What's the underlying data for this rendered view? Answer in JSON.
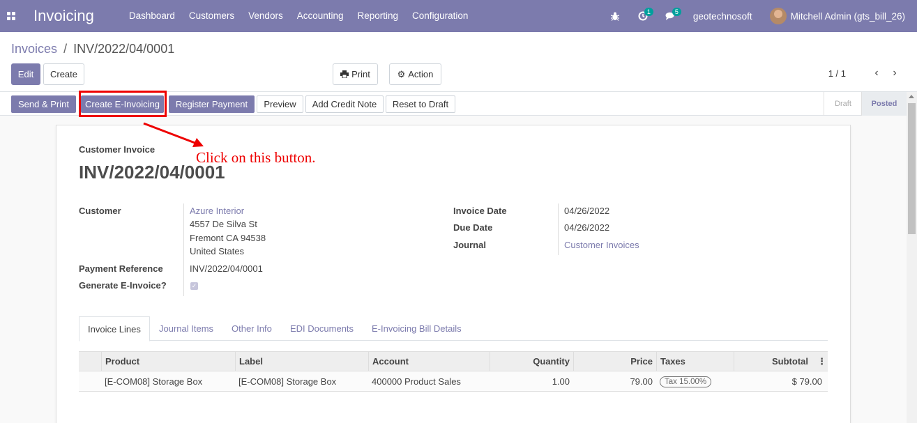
{
  "navbar": {
    "app_name": "Invoicing",
    "menu": [
      "Dashboard",
      "Customers",
      "Vendors",
      "Accounting",
      "Reporting",
      "Configuration"
    ],
    "activity_count": "1",
    "messages_count": "5",
    "company": "geotechnosoft",
    "user": "Mitchell Admin (gts_bill_26)"
  },
  "breadcrumb": {
    "parent": "Invoices",
    "separator": "/",
    "current": "INV/2022/04/0001"
  },
  "toolbar": {
    "edit": "Edit",
    "create": "Create",
    "print": "Print",
    "action": "Action",
    "pager": "1 / 1"
  },
  "statusbar": {
    "buttons": [
      "Send & Print",
      "Create E-Invoicing",
      "Register Payment",
      "Preview",
      "Add Credit Note",
      "Reset to Draft"
    ],
    "stages": [
      "Draft",
      "Posted"
    ]
  },
  "annotation": {
    "text": "Click on this button.",
    "color": "#ee0000"
  },
  "invoice": {
    "type": "Customer Invoice",
    "number": "INV/2022/04/0001",
    "customer_label": "Customer",
    "customer_name": "Azure Interior",
    "address_line1": "4557 De Silva St",
    "address_line2": "Fremont CA 94538",
    "address_line3": "United States",
    "payment_ref_label": "Payment Reference",
    "payment_ref": "INV/2022/04/0001",
    "generate_einvoice_label": "Generate E-Invoice?",
    "generate_einvoice_checked": true,
    "invoice_date_label": "Invoice Date",
    "invoice_date": "04/26/2022",
    "due_date_label": "Due Date",
    "due_date": "04/26/2022",
    "journal_label": "Journal",
    "journal": "Customer Invoices"
  },
  "tabs": [
    "Invoice Lines",
    "Journal Items",
    "Other Info",
    "EDI Documents",
    "E-Invoicing Bill Details"
  ],
  "lines_table": {
    "columns": [
      "Product",
      "Label",
      "Account",
      "Quantity",
      "Price",
      "Taxes",
      "Subtotal"
    ],
    "rows": [
      {
        "product": "[E-COM08] Storage Box",
        "label": "[E-COM08] Storage Box",
        "account": "400000 Product Sales",
        "quantity": "1.00",
        "price": "79.00",
        "taxes": "Tax 15.00%",
        "subtotal": "$ 79.00"
      }
    ]
  },
  "colors": {
    "brand": "#7c7bad",
    "highlight": "#ee0000"
  }
}
